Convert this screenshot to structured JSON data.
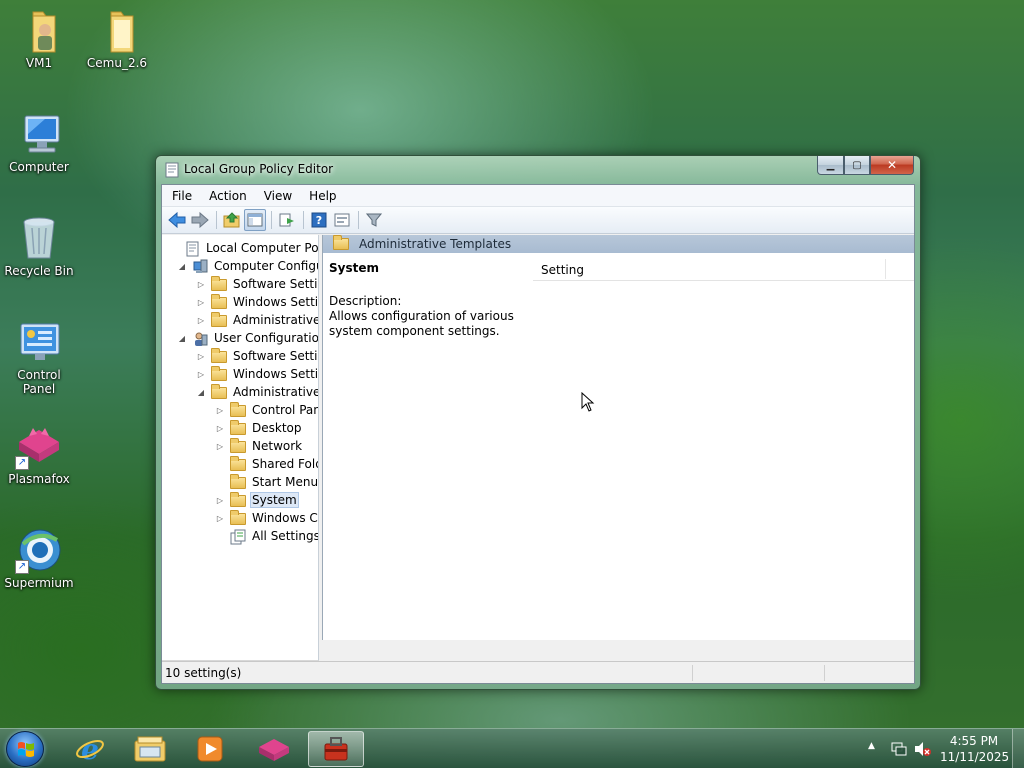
{
  "desktop": {
    "icons": [
      {
        "label": "VM1",
        "icon": "user-folder-icon"
      },
      {
        "label": "Cemu_2.6",
        "icon": "folder-icon"
      },
      {
        "label": "Computer",
        "icon": "computer-icon"
      },
      {
        "label": "Recycle Bin",
        "icon": "recycle-bin-icon"
      },
      {
        "label": "Control Panel",
        "icon": "control-panel-icon"
      },
      {
        "label": "Plasmafox",
        "icon": "plasmafox-icon"
      },
      {
        "label": "Supermium",
        "icon": "supermium-icon"
      }
    ]
  },
  "window": {
    "title": "Local Group Policy Editor",
    "menu": [
      "File",
      "Action",
      "View",
      "Help"
    ],
    "toolbar_icons": [
      "back-icon",
      "forward-icon",
      "up-folder-icon",
      "show-hide-tree-icon",
      "export-list-icon",
      "help-icon",
      "properties-icon",
      "filter-icon"
    ],
    "tree": [
      {
        "label": "Local Computer Policy",
        "level": 0,
        "expander": "",
        "icon": "policy-icon"
      },
      {
        "label": "Computer Configura",
        "level": 1,
        "expander": "◢",
        "icon": "computer-config-icon"
      },
      {
        "label": "Software Settings",
        "level": 2,
        "expander": "▷",
        "icon": "folder-icon"
      },
      {
        "label": "Windows Setting",
        "level": 2,
        "expander": "▷",
        "icon": "folder-icon"
      },
      {
        "label": "Administrative Te",
        "level": 2,
        "expander": "▷",
        "icon": "folder-icon"
      },
      {
        "label": "User Configuration",
        "level": 1,
        "expander": "◢",
        "icon": "user-config-icon"
      },
      {
        "label": "Software Settings",
        "level": 2,
        "expander": "▷",
        "icon": "folder-icon"
      },
      {
        "label": "Windows Setting",
        "level": 2,
        "expander": "▷",
        "icon": "folder-icon"
      },
      {
        "label": "Administrative Te",
        "level": 2,
        "expander": "◢",
        "icon": "folder-icon"
      },
      {
        "label": "Control Panel",
        "level": 3,
        "expander": "▷",
        "icon": "folder-icon"
      },
      {
        "label": "Desktop",
        "level": 3,
        "expander": "▷",
        "icon": "folder-icon"
      },
      {
        "label": "Network",
        "level": 3,
        "expander": "▷",
        "icon": "folder-icon"
      },
      {
        "label": "Shared Folder",
        "level": 3,
        "expander": "",
        "icon": "folder-icon"
      },
      {
        "label": "Start Menu ar",
        "level": 3,
        "expander": "",
        "icon": "folder-icon"
      },
      {
        "label": "System",
        "level": 3,
        "expander": "▷",
        "icon": "folder-icon",
        "selected": true
      },
      {
        "label": "Windows Cor",
        "level": 3,
        "expander": "▷",
        "icon": "folder-icon"
      },
      {
        "label": "All Settings",
        "level": 3,
        "expander": "",
        "icon": "all-settings-icon"
      }
    ],
    "right_pane": {
      "header": "Administrative Templates",
      "selected_title": "System",
      "description_label": "Description:",
      "description_text": "Allows configuration of various system component settings.",
      "column_header": "Setting"
    },
    "status": "10 setting(s)"
  },
  "taskbar": {
    "apps": [
      "internet-explorer-icon",
      "file-explorer-icon",
      "media-player-icon",
      "plasmafox-icon",
      "group-policy-icon"
    ],
    "active_app": "group-policy-icon",
    "clock_time": "4:55 PM",
    "clock_date": "11/11/2025"
  }
}
